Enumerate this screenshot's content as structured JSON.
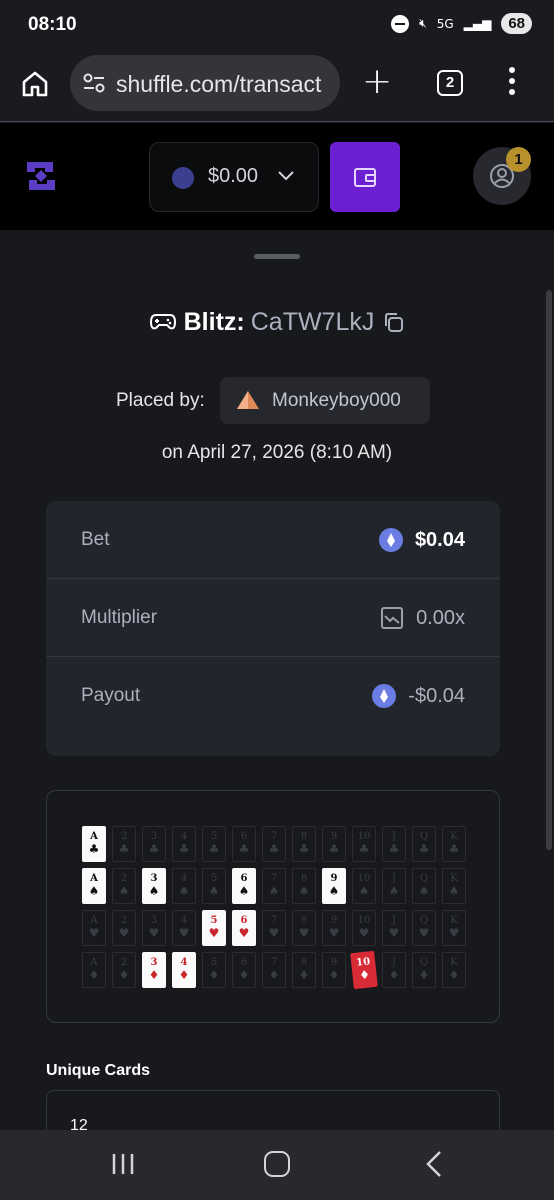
{
  "status_bar": {
    "time": "08:10",
    "network": "5G",
    "battery": "68"
  },
  "browser": {
    "url": "shuffle.com/transact",
    "tab_count": "2"
  },
  "header": {
    "balance": "$0.00",
    "notification_count": "1"
  },
  "bet": {
    "game_label": "Blitz:",
    "bet_id": "CaTW7LkJ",
    "placed_by_label": "Placed by:",
    "username": "Monkeyboy000",
    "date_text": "on April 27, 2026 (8:10 AM)",
    "rows": [
      {
        "label": "Bet",
        "value": "$0.04"
      },
      {
        "label": "Multiplier",
        "value": "0.00x"
      },
      {
        "label": "Payout",
        "value": "-$0.04"
      }
    ]
  },
  "cards": {
    "ranks": [
      "A",
      "2",
      "3",
      "4",
      "5",
      "6",
      "7",
      "8",
      "9",
      "10",
      "J",
      "Q",
      "K"
    ],
    "suits": [
      "clubs",
      "spades",
      "hearts",
      "diamonds"
    ],
    "suit_glyphs": {
      "clubs": "♣",
      "spades": "♠",
      "hearts": "♥",
      "diamonds": "♦"
    },
    "drawn": {
      "clubs": [
        "A"
      ],
      "spades": [
        "A",
        "3",
        "6",
        "9"
      ],
      "hearts": [
        "5",
        "6"
      ],
      "diamonds": [
        "3",
        "4"
      ]
    },
    "highlighted": {
      "suit": "diamonds",
      "rank": "10"
    }
  },
  "unique_cards": {
    "label": "Unique Cards",
    "value": "12"
  },
  "colors": {
    "accent": "#6b1fd1",
    "background": "#18191d",
    "panel": "#23252c",
    "highlight_card": "#d92b35"
  }
}
